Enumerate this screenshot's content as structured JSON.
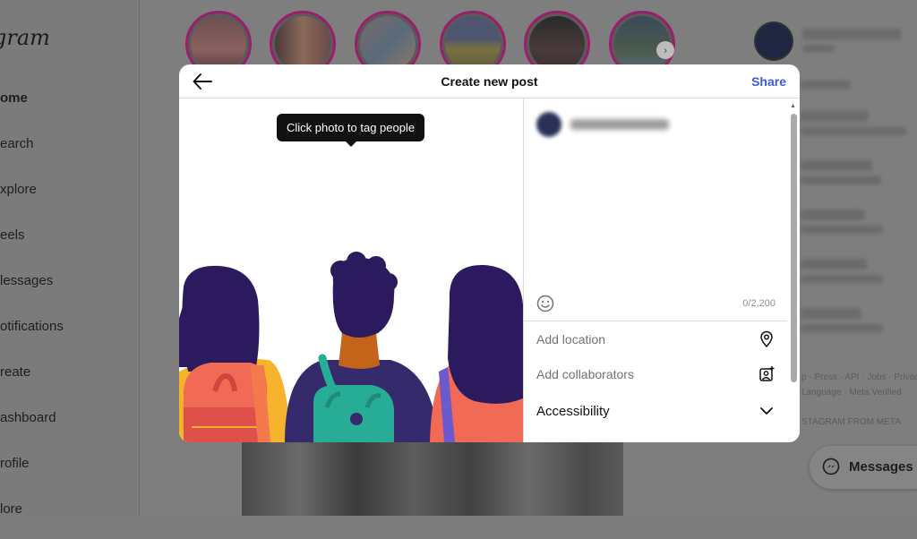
{
  "background": {
    "logo_text": "gram",
    "nav": [
      "ome",
      "earch",
      "xplore",
      "eels",
      "lessages",
      "otifications",
      "reate",
      "ashboard",
      "rofile",
      "lore"
    ],
    "footer_links": "p · Press · API · Jobs · Privac",
    "footer_meta": "Language · Meta Verified",
    "footer_brand": "STAGRAM FROM META",
    "messages_label": "Messages"
  },
  "modal": {
    "title": "Create new post",
    "share_label": "Share",
    "tooltip": "Click photo to tag people",
    "char_count": "0/2,200",
    "rows": [
      {
        "label": "Add location",
        "icon": "location-pin-icon"
      },
      {
        "label": "Add collaborators",
        "icon": "add-collaborator-icon"
      },
      {
        "label": "Accessibility",
        "icon": "chevron-down-icon"
      }
    ]
  },
  "colors": {
    "accent": "#3b5bd6",
    "hair": "#2b1b5e",
    "shirt_purple": "#352a6b",
    "bag_teal": "#27ad96",
    "coral": "#f06a55",
    "yellow": "#f7b32b",
    "skin": "#c4641a"
  }
}
